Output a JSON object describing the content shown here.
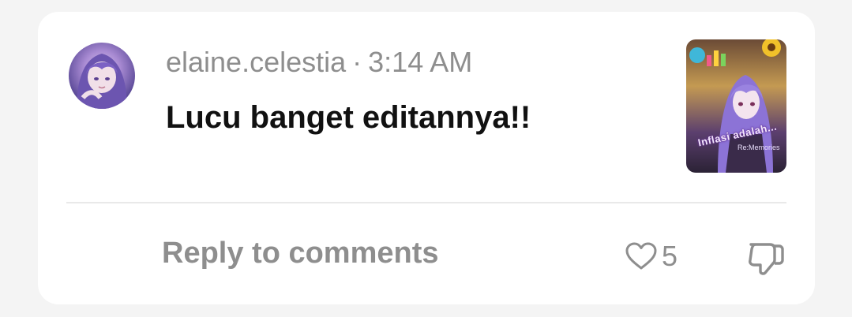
{
  "comment": {
    "username": "elaine.celestia",
    "separator": "·",
    "time": "3:14 AM",
    "text": "Lucu banget editannya!!",
    "thumbnail": {
      "title": "Inflasi adalah...",
      "subtitle": "Re:Memories"
    }
  },
  "actions": {
    "reply_label": "Reply to comments",
    "like_count": "5",
    "like_icon": "heart-outline",
    "dislike_icon": "thumbs-down-outline"
  }
}
